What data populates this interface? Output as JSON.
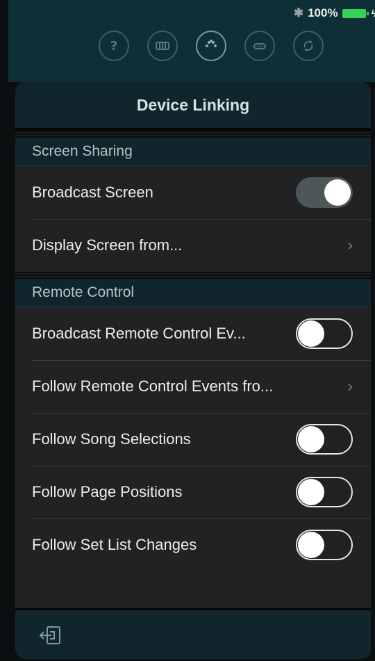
{
  "status_bar": {
    "battery_text": "100%"
  },
  "toolbar": {
    "icons": [
      "help-icon",
      "keyboard-icon",
      "midi-icon",
      "link-icon",
      "sync-icon"
    ]
  },
  "popover": {
    "title": "Device Linking"
  },
  "screen_sharing": {
    "header": "Screen Sharing",
    "broadcast_screen": {
      "label": "Broadcast Screen",
      "on": true
    },
    "display_screen_from": {
      "label": "Display Screen from..."
    }
  },
  "remote_control": {
    "header": "Remote Control",
    "broadcast_events": {
      "label": "Broadcast Remote Control Ev...",
      "on": false
    },
    "follow_events_from": {
      "label": "Follow Remote Control Events fro..."
    },
    "follow_song_selections": {
      "label": "Follow Song Selections",
      "on": false
    },
    "follow_page_positions": {
      "label": "Follow Page Positions",
      "on": false
    },
    "follow_set_list_changes": {
      "label": "Follow Set List Changes",
      "on": false
    }
  },
  "footer": {
    "icon": "exit-icon"
  },
  "colors": {
    "header_bg": "#10262c",
    "row_bg": "#202223",
    "battery": "#34d058"
  }
}
